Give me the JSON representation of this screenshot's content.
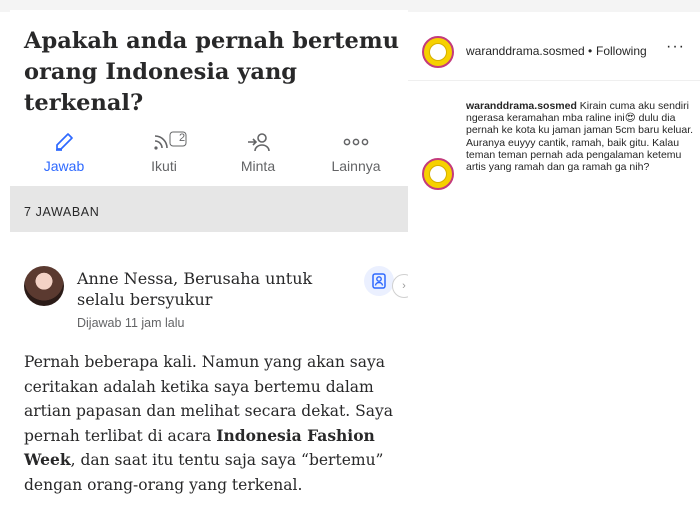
{
  "question": {
    "title": "Apakah anda pernah bertemu orang Indonesia yang terkenal?"
  },
  "actions": {
    "answer_label": "Jawab",
    "follow_label": "Ikuti",
    "follow_count": "2",
    "request_label": "Minta",
    "more_label": "Lainnya"
  },
  "answers_bar": {
    "label": "7 JAWABAN"
  },
  "author": {
    "name": "Anne Nessa, Berusaha untuk selalu bersyukur",
    "answered": "Dijawab 11 jam lalu"
  },
  "answer": {
    "part1": "Pernah beberapa kali. Namun yang akan saya ceritakan adalah ketika saya bertemu dalam artian papasan dan melihat secara dekat. Saya pernah terlibat di acara ",
    "bold": "Indonesia Fashion Week",
    "part2": ", dan saat itu tentu saja saya “bertemu” dengan orang-orang yang terkenal."
  },
  "instagram": {
    "username": "waranddrama.sosmed",
    "separator": "•",
    "following_label": "Following",
    "more": "···",
    "caption_user": "waranddrama.sosmed",
    "caption_part1": " Kirain cuma aku sendiri ngerasa keramahan mba raline ini",
    "caption_emoji": "😍",
    "caption_part2": " dulu dia pernah ke kota ku jaman jaman 5cm baru keluar. Auranya euyyy cantik, ramah, baik gitu. Kalau teman teman pernah ada pengalaman ketemu artis yang ramah dan ga ramah ga nih?"
  },
  "colors": {
    "accent_blue": "#2e69ff",
    "text_dark": "#282829",
    "text_muted": "#636466",
    "bar_bg": "#e6e6e6",
    "ig_avatar": "#f6d100"
  }
}
